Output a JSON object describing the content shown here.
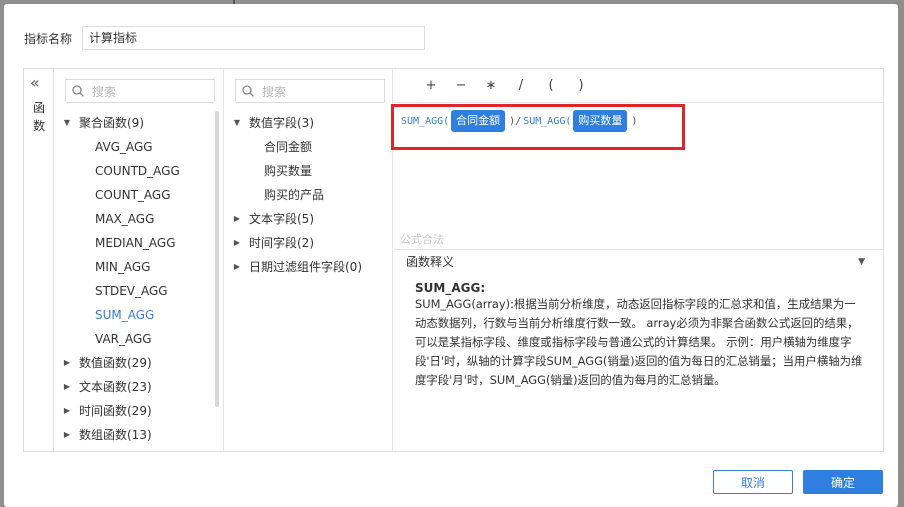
{
  "name_field": {
    "label": "指标名称",
    "value": "计算指标"
  },
  "collapse": {
    "chevron": "«",
    "label": "函数"
  },
  "functions": {
    "search_placeholder": "搜索",
    "groups": [
      {
        "label": "聚合函数(9)",
        "expanded": true,
        "items": [
          "AVG_AGG",
          "COUNTD_AGG",
          "COUNT_AGG",
          "MAX_AGG",
          "MEDIAN_AGG",
          "MIN_AGG",
          "STDEV_AGG",
          "SUM_AGG",
          "VAR_AGG"
        ],
        "active_item": "SUM_AGG"
      },
      {
        "label": "数值函数(29)",
        "expanded": false
      },
      {
        "label": "文本函数(23)",
        "expanded": false
      },
      {
        "label": "时间函数(29)",
        "expanded": false
      },
      {
        "label": "数组函数(13)",
        "expanded": false
      }
    ]
  },
  "fields": {
    "search_placeholder": "搜索",
    "groups": [
      {
        "label": "数值字段(3)",
        "expanded": true,
        "items": [
          "合同金额",
          "购买数量",
          "购买的产品"
        ]
      },
      {
        "label": "文本字段(5)",
        "expanded": false
      },
      {
        "label": "时间字段(2)",
        "expanded": false
      },
      {
        "label": "日期过滤组件字段(0)",
        "expanded": false
      }
    ]
  },
  "operators": [
    "+",
    "−",
    "∗",
    "/",
    "(",
    ")"
  ],
  "formula": {
    "fn1": "SUM_AGG(",
    "field1": "合同金额",
    "mid": ")/",
    "fn2": "SUM_AGG(",
    "field2": "购买数量",
    "end": ")"
  },
  "validation_text": "公式合法",
  "explanation": {
    "header": "函数释义",
    "title": "SUM_AGG:",
    "body": "SUM_AGG(array):根据当前分析维度，动态返回指标字段的汇总求和值，生成结果为一动态数据列，行数与当前分析维度行数一致。 array必须为非聚合函数公式返回的结果，可以是某指标字段、维度或指标字段与普通公式的计算结果。 示例：用户横轴为维度字段'日'时，纵轴的计算字段SUM_AGG(销量)返回的值为每日的汇总销量；当用户横轴为维度字段'月'时，SUM_AGG(销量)返回的值为每月的汇总销量。"
  },
  "buttons": {
    "cancel": "取消",
    "ok": "确定"
  },
  "colors": {
    "accent": "#2f7fe0",
    "highlight_border": "#e0252a"
  }
}
